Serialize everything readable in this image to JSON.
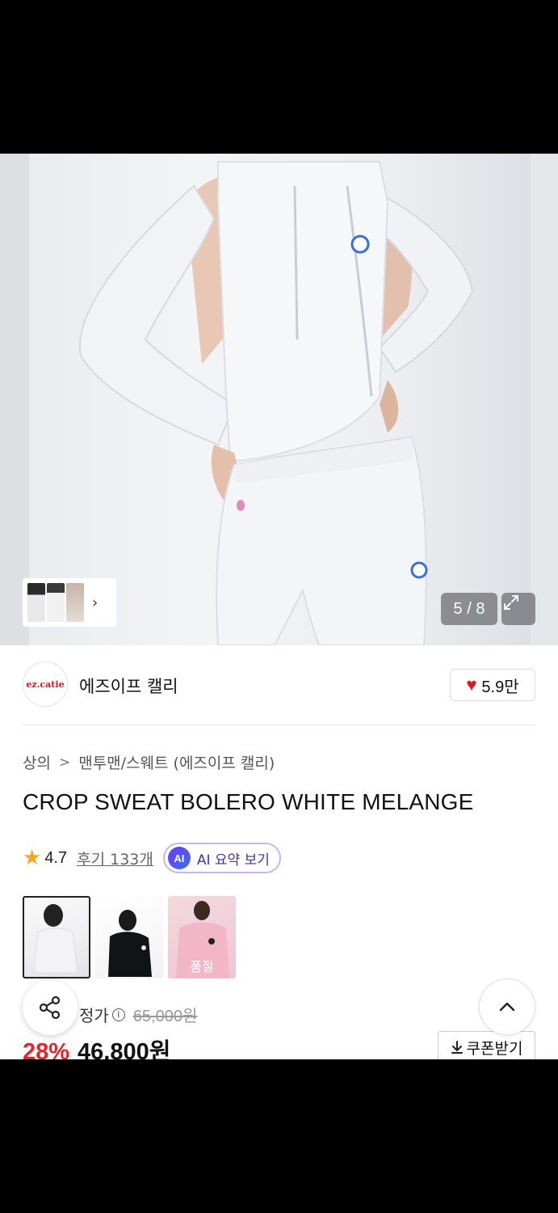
{
  "gallery": {
    "counter": "5 / 8",
    "thumbnail_chevron": "›"
  },
  "brand": {
    "logo_text": "ez.catie",
    "name": "에즈이프 캘리",
    "likes": "5.9만"
  },
  "breadcrumb": {
    "category": "상의",
    "separator": ">",
    "subcategory": "맨투맨/스웨트 (에즈이프 캘리)"
  },
  "product": {
    "title": "CROP SWEAT BOLERO WHITE MELANGE",
    "rating": "4.7",
    "reviews": "후기 133개",
    "ai_badge": "AI",
    "ai_summary": "AI 요약 보기"
  },
  "variants": [
    {
      "name": "white",
      "soldout": ""
    },
    {
      "name": "black",
      "soldout": ""
    },
    {
      "name": "pink",
      "soldout": "품절"
    }
  ],
  "price": {
    "label_partial": "정가",
    "original": "65,000원",
    "discount": "28%",
    "final": "46,800원",
    "coupon": "쿠폰받기"
  },
  "icons": [
    "share-icon",
    "chevron-up-icon",
    "expand-icon",
    "heart-icon",
    "star-icon",
    "info-icon",
    "download-icon"
  ],
  "colors": {
    "sale_red": "#e5242b",
    "heart_red": "#e8141f",
    "star": "#f5a623",
    "ai_purple": "#4a2fb0"
  }
}
